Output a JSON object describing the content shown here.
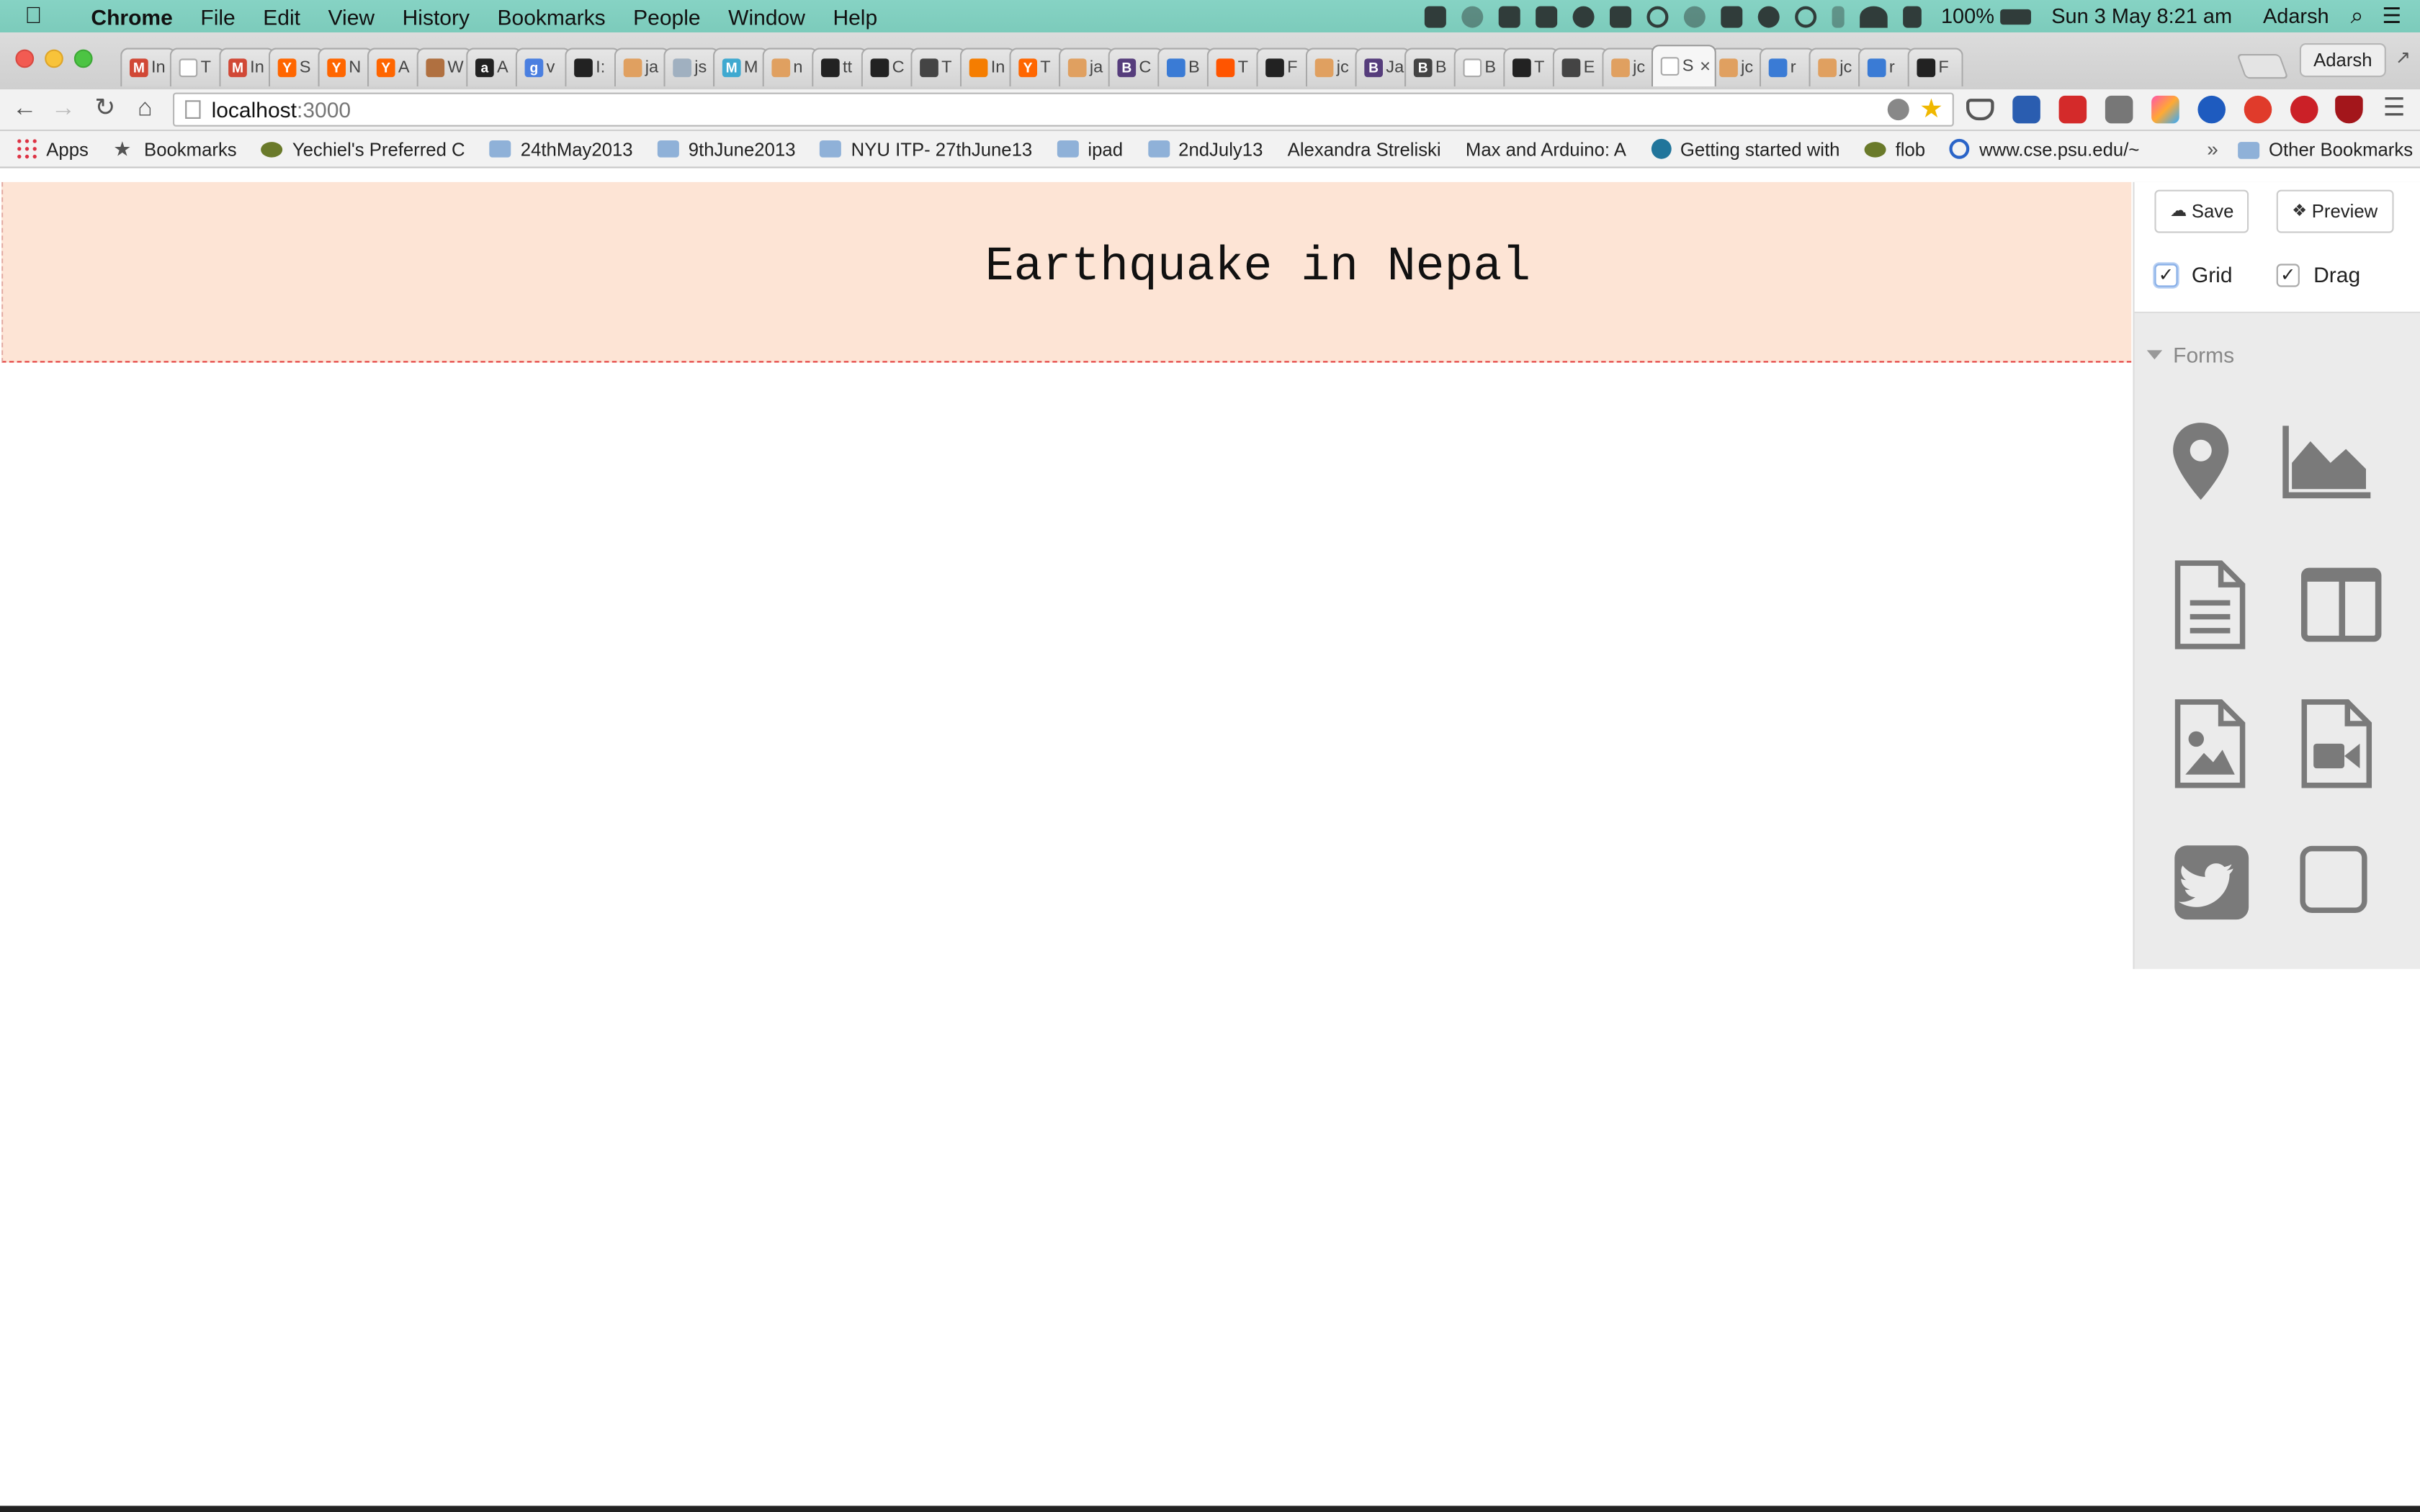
{
  "menubar": {
    "app": "Chrome",
    "items": [
      "File",
      "Edit",
      "View",
      "History",
      "Bookmarks",
      "People",
      "Window",
      "Help"
    ],
    "battery": "100%",
    "datetime": "Sun 3 May  8:21 am",
    "user": "Adarsh"
  },
  "tabstrip": {
    "tabs": [
      {
        "fav": "M",
        "color": "#d14836",
        "label": "In"
      },
      {
        "fav": "",
        "color": "#ffffff",
        "label": "T"
      },
      {
        "fav": "M",
        "color": "#d14836",
        "label": "In"
      },
      {
        "fav": "Y",
        "color": "#ff6600",
        "label": "S"
      },
      {
        "fav": "Y",
        "color": "#ff6600",
        "label": "N"
      },
      {
        "fav": "Y",
        "color": "#ff6600",
        "label": "A"
      },
      {
        "fav": "",
        "color": "#b07040",
        "label": "W"
      },
      {
        "fav": "a",
        "color": "#222222",
        "label": "A"
      },
      {
        "fav": "g",
        "color": "#4a7fe0",
        "label": "v"
      },
      {
        "fav": "",
        "color": "#222222",
        "label": "I:"
      },
      {
        "fav": "",
        "color": "#e0a060",
        "label": "ja"
      },
      {
        "fav": "",
        "color": "#a0b0c0",
        "label": "js"
      },
      {
        "fav": "M",
        "color": "#3fa9d0",
        "label": "M"
      },
      {
        "fav": "",
        "color": "#e0a060",
        "label": "n"
      },
      {
        "fav": "",
        "color": "#222222",
        "label": "tt"
      },
      {
        "fav": "",
        "color": "#222222",
        "label": "C"
      },
      {
        "fav": "",
        "color": "#444444",
        "label": "T"
      },
      {
        "fav": "",
        "color": "#f57d00",
        "label": "In"
      },
      {
        "fav": "Y",
        "color": "#ff6600",
        "label": "T"
      },
      {
        "fav": "",
        "color": "#e0a060",
        "label": "ja"
      },
      {
        "fav": "B",
        "color": "#563d7c",
        "label": "C"
      },
      {
        "fav": "",
        "color": "#3a7bd5",
        "label": "B"
      },
      {
        "fav": "",
        "color": "#ff5500",
        "label": "T"
      },
      {
        "fav": "",
        "color": "#222222",
        "label": "F"
      },
      {
        "fav": "",
        "color": "#e0a060",
        "label": "jc"
      },
      {
        "fav": "B",
        "color": "#563d7c",
        "label": "Ja"
      },
      {
        "fav": "B",
        "color": "#444444",
        "label": "B"
      },
      {
        "fav": "",
        "color": "#ffffff",
        "label": "B"
      },
      {
        "fav": "",
        "color": "#222222",
        "label": "T"
      },
      {
        "fav": "",
        "color": "#444444",
        "label": "E"
      },
      {
        "fav": "",
        "color": "#e0a060",
        "label": "jc"
      },
      {
        "fav": "",
        "color": "#ffffff",
        "label": "S",
        "active": true
      },
      {
        "fav": "",
        "color": "#e0a060",
        "label": "jc"
      },
      {
        "fav": "",
        "color": "#3a7bd5",
        "label": "r"
      },
      {
        "fav": "",
        "color": "#e0a060",
        "label": "jc"
      },
      {
        "fav": "",
        "color": "#3a7bd5",
        "label": "r"
      },
      {
        "fav": "",
        "color": "#222222",
        "label": "F"
      }
    ],
    "profile": "Adarsh"
  },
  "toolbar": {
    "url_host": "localhost",
    "url_port": ":3000"
  },
  "bookmarks": {
    "items": [
      {
        "icon": "grid",
        "label": "Apps"
      },
      {
        "icon": "star",
        "label": "Bookmarks"
      },
      {
        "icon": "bug",
        "label": "Yechiel's Preferred C"
      },
      {
        "icon": "folder",
        "label": "24thMay2013"
      },
      {
        "icon": "folder",
        "label": "9thJune2013"
      },
      {
        "icon": "folder",
        "label": "NYU ITP- 27thJune13"
      },
      {
        "icon": "folder",
        "label": "ipad"
      },
      {
        "icon": "folder",
        "label": "2ndJuly13"
      },
      {
        "icon": "page",
        "label": "Alexandra Streliski"
      },
      {
        "icon": "page",
        "label": "Max and Arduino: A"
      },
      {
        "icon": "wp",
        "label": "Getting started with"
      },
      {
        "icon": "bug",
        "label": "flob"
      },
      {
        "icon": "circ",
        "label": "www.cse.psu.edu/~"
      }
    ],
    "chevron": "»",
    "other": "Other Bookmarks"
  },
  "page": {
    "title": "Earthquake in Nepal"
  },
  "panel": {
    "save_label": "Save",
    "preview_label": "Preview",
    "grid_label": "Grid",
    "drag_label": "Drag",
    "forms_label": "Forms",
    "tools": [
      "map-marker-icon",
      "area-chart-icon",
      "text-document-icon",
      "columns-layout-icon",
      "image-file-icon",
      "video-file-icon",
      "twitter-icon",
      "empty-box-icon"
    ]
  }
}
